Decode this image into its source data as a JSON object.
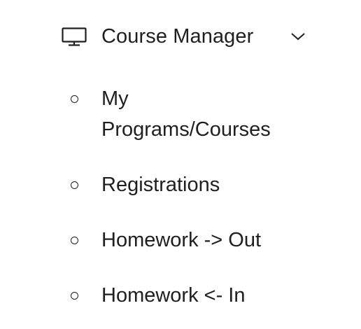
{
  "menu": {
    "title": "Course Manager",
    "icon": "monitor-icon",
    "toggle_icon": "chevron-down-icon",
    "expanded": true,
    "items": [
      {
        "label": "My Programs/Courses",
        "icon": "circle-bullet-icon"
      },
      {
        "label": "Registrations",
        "icon": "circle-bullet-icon"
      },
      {
        "label": "Homework -> Out",
        "icon": "circle-bullet-icon"
      },
      {
        "label": "Homework <- In",
        "icon": "circle-bullet-icon"
      }
    ]
  },
  "colors": {
    "text": "#1f1f1f",
    "background": "#ffffff"
  }
}
